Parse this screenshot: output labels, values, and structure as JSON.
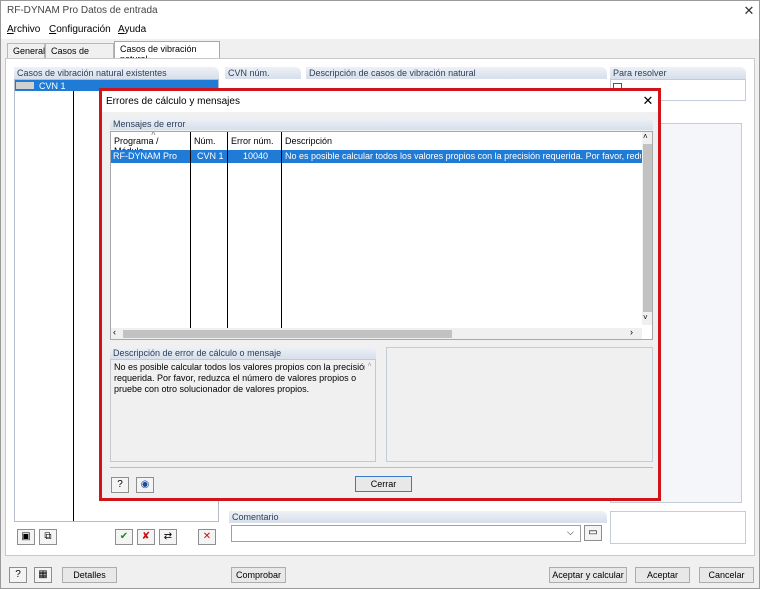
{
  "window": {
    "title": "RF-DYNAM Pro Datos de entrada"
  },
  "menu": [
    {
      "label": "Archivo",
      "u": "A",
      "rest": "rchivo"
    },
    {
      "label": "Configuración",
      "u": "C",
      "rest": "onfiguración"
    },
    {
      "label": "Ayuda",
      "u": "A",
      "rest": "yuda"
    }
  ],
  "tabs": [
    "General",
    "Casos de masas",
    "Casos de vibración natural"
  ],
  "left_panel": {
    "header": "Casos de vibración natural existentes",
    "item": "CVN 1"
  },
  "cvn_header": "CVN núm.",
  "desc_header": "Descripción de casos de vibración natural",
  "solve_header": "Para resolver",
  "comment_header": "Comentario",
  "dialog": {
    "title": "Errores de cálculo y mensajes",
    "group_header": "Mensajes de error",
    "columns": [
      "Programa / Módulo",
      "Núm.",
      "Error núm.",
      "Descripción"
    ],
    "row": {
      "program": "RF-DYNAM Pro",
      "num": "CVN 1",
      "error": "10040",
      "desc": "No es posible calcular todos los valores propios con la precisión requerida. Por favor, reduzca el n"
    },
    "detail_header": "Descripción de error de cálculo o mensaje",
    "detail_lines": [
      "No es posible calcular todos los valores propios con la precisión",
      "requerida. Por favor, reduzca el número de valores propios o",
      "pruebe con otro solucionador de valores propios."
    ],
    "close_button": "Cerrar"
  },
  "bottom_buttons": {
    "details": "Detalles",
    "check": "Comprobar",
    "accept_calc": "Aceptar y calcular",
    "accept": "Aceptar",
    "cancel": "Cancelar"
  },
  "icons": {
    "help": "help-icon",
    "view": "eye-icon"
  },
  "colors": {
    "selection": "#1f7bd6",
    "dialog_border": "#d0141a"
  }
}
